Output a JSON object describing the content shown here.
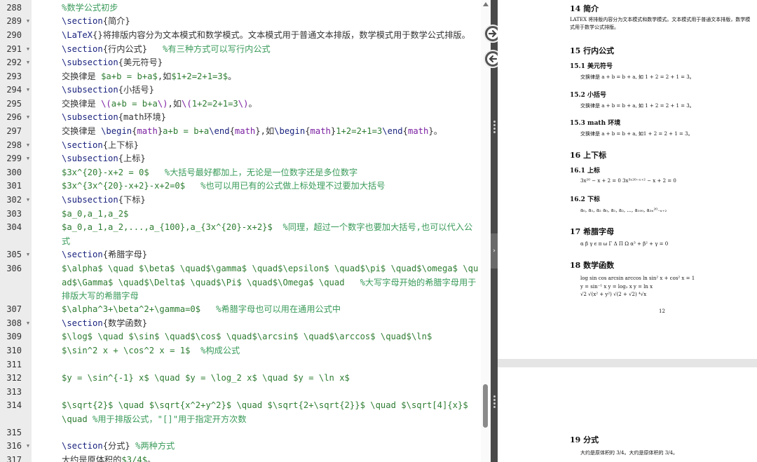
{
  "editor": {
    "lines": [
      {
        "num": "288",
        "fold": false,
        "segs": [
          [
            "t-comment",
            "%数学公式初步"
          ]
        ]
      },
      {
        "num": "289",
        "fold": true,
        "segs": [
          [
            "t-cmd",
            "\\section"
          ],
          [
            "t-brace",
            "{简介}"
          ]
        ]
      },
      {
        "num": "290",
        "fold": false,
        "segs": [
          [
            "t-cmd",
            "\\LaTeX"
          ],
          [
            "t-brace",
            "{}"
          ],
          [
            "t-text",
            "将排版内容分为文本模式和数学模式。文本模式用于普通文本排版，数学模式用于数学公式排版。"
          ]
        ]
      },
      {
        "num": "291",
        "fold": true,
        "segs": [
          [
            "t-cmd",
            "\\section"
          ],
          [
            "t-brace",
            "{行内公式}"
          ],
          [
            "t-comment",
            "   %有三种方式可以写行内公式"
          ]
        ]
      },
      {
        "num": "292",
        "fold": true,
        "segs": [
          [
            "t-cmd",
            "\\subsection"
          ],
          [
            "t-brace",
            "{美元符号}"
          ]
        ]
      },
      {
        "num": "293",
        "fold": false,
        "segs": [
          [
            "t-text",
            "交换律是 "
          ],
          [
            "t-math",
            "$a+b = b+a$"
          ],
          [
            "t-text",
            ",如"
          ],
          [
            "t-math",
            "$1+2=2+1=3$"
          ],
          [
            "t-text",
            "。"
          ]
        ]
      },
      {
        "num": "294",
        "fold": true,
        "segs": [
          [
            "t-cmd",
            "\\subsection"
          ],
          [
            "t-brace",
            "{小括号}"
          ]
        ]
      },
      {
        "num": "295",
        "fold": false,
        "segs": [
          [
            "t-text",
            "交换律是 "
          ],
          [
            "t-inner",
            "\\("
          ],
          [
            "t-math",
            "a+b = b+a"
          ],
          [
            "t-inner",
            "\\)"
          ],
          [
            "t-text",
            ",如"
          ],
          [
            "t-inner",
            "\\("
          ],
          [
            "t-math",
            "1+2=2+1=3"
          ],
          [
            "t-inner",
            "\\)"
          ],
          [
            "t-text",
            "。"
          ]
        ]
      },
      {
        "num": "296",
        "fold": true,
        "segs": [
          [
            "t-cmd",
            "\\subsection"
          ],
          [
            "t-brace",
            "{math环境}"
          ]
        ]
      },
      {
        "num": "297",
        "fold": false,
        "segs": [
          [
            "t-text",
            "交换律是 "
          ],
          [
            "t-cmd",
            "\\begin"
          ],
          [
            "t-brace",
            "{"
          ],
          [
            "t-inner",
            "math"
          ],
          [
            "t-brace",
            "}"
          ],
          [
            "t-math",
            "a+b = b+a"
          ],
          [
            "t-cmd",
            "\\end"
          ],
          [
            "t-brace",
            "{"
          ],
          [
            "t-inner",
            "math"
          ],
          [
            "t-brace",
            "}"
          ],
          [
            "t-text",
            ",如"
          ],
          [
            "t-cmd",
            "\\begin"
          ],
          [
            "t-brace",
            "{"
          ],
          [
            "t-inner",
            "math"
          ],
          [
            "t-brace",
            "}"
          ],
          [
            "t-math",
            "1+2=2+1=3"
          ],
          [
            "t-cmd",
            "\\end"
          ],
          [
            "t-brace",
            "{"
          ],
          [
            "t-inner",
            "math"
          ],
          [
            "t-brace",
            "}"
          ],
          [
            "t-text",
            "。"
          ]
        ]
      },
      {
        "num": "298",
        "fold": true,
        "segs": [
          [
            "t-cmd",
            "\\section"
          ],
          [
            "t-brace",
            "{上下标}"
          ]
        ]
      },
      {
        "num": "299",
        "fold": true,
        "segs": [
          [
            "t-cmd",
            "\\subsection"
          ],
          [
            "t-brace",
            "{上标}"
          ]
        ]
      },
      {
        "num": "300",
        "fold": false,
        "segs": [
          [
            "t-math",
            "$3x^{20}-x+2 = 0$"
          ],
          [
            "t-comment",
            "   %大括号最好都加上，无论是一位数字还是多位数字"
          ]
        ]
      },
      {
        "num": "301",
        "fold": false,
        "segs": [
          [
            "t-math",
            "$3x^{3x^{20}-x+2}-x+2=0$"
          ],
          [
            "t-comment",
            "   %也可以用已有的公式做上标处理不过要加大括号"
          ]
        ]
      },
      {
        "num": "302",
        "fold": true,
        "segs": [
          [
            "t-cmd",
            "\\subsection"
          ],
          [
            "t-brace",
            "{下标}"
          ]
        ]
      },
      {
        "num": "303",
        "fold": false,
        "segs": [
          [
            "t-math",
            "$a_0,a_1,a_2$"
          ]
        ]
      },
      {
        "num": "304",
        "fold": false,
        "segs": [
          [
            "t-math",
            "$a_0,a_1,a_2,...,a_{100},a_{3x^{20}-x+2}$"
          ],
          [
            "t-comment",
            "  %同理，超过一个数字也要加大括号,也可以代入公式"
          ]
        ]
      },
      {
        "num": "305",
        "fold": true,
        "segs": [
          [
            "t-cmd",
            "\\section"
          ],
          [
            "t-brace",
            "{希腊字母}"
          ]
        ]
      },
      {
        "num": "306",
        "fold": false,
        "segs": [
          [
            "t-math",
            "$\\alpha$ \\quad $\\beta$ \\quad$\\gamma$ \\quad$\\epsilon$ \\quad$\\pi$ \\quad$\\omega$ \\quad$\\Gamma$ \\quad$\\Delta$ \\quad$\\Pi$ \\quad$\\Omega$ \\quad"
          ],
          [
            "t-comment",
            "   %大写字母开始的希腊字母用于排版大写的希腊字母"
          ]
        ]
      },
      {
        "num": "307",
        "fold": false,
        "segs": [
          [
            "t-math",
            "$\\alpha^3+\\beta^2+\\gamma=0$"
          ],
          [
            "t-comment",
            "   %希腊字母也可以用在通用公式中"
          ]
        ]
      },
      {
        "num": "308",
        "fold": true,
        "segs": [
          [
            "t-cmd",
            "\\section"
          ],
          [
            "t-brace",
            "{数学函数}"
          ]
        ]
      },
      {
        "num": "309",
        "fold": false,
        "segs": [
          [
            "t-math",
            "$\\log$ \\quad $\\sin$ \\quad$\\cos$ \\quad$\\arcsin$ \\quad$\\arccos$ \\quad$\\ln$"
          ]
        ]
      },
      {
        "num": "310",
        "fold": false,
        "segs": [
          [
            "t-math",
            "$\\sin^2 x + \\cos^2 x = 1$"
          ],
          [
            "t-comment",
            "  %构成公式"
          ]
        ]
      },
      {
        "num": "311",
        "fold": false,
        "segs": []
      },
      {
        "num": "312",
        "fold": false,
        "segs": [
          [
            "t-math",
            "$y = \\sin^{-1} x$ \\quad $y = \\log_2 x$ \\quad $y = \\ln x$"
          ]
        ]
      },
      {
        "num": "313",
        "fold": false,
        "segs": []
      },
      {
        "num": "314",
        "fold": false,
        "segs": [
          [
            "t-math",
            "$\\sqrt{2}$ \\quad $\\sqrt{x^2+y^2}$ \\quad $\\sqrt{2+\\sqrt{2}}$ \\quad $\\sqrt[4]{x}$ \\quad "
          ],
          [
            "t-comment",
            "%用于排版公式，\"[]\"用于指定开方次数"
          ]
        ]
      },
      {
        "num": "315",
        "fold": false,
        "segs": []
      },
      {
        "num": "316",
        "fold": true,
        "segs": [
          [
            "t-cmd",
            "\\section"
          ],
          [
            "t-brace",
            "{分式}"
          ],
          [
            "t-comment",
            " %两种方式"
          ]
        ]
      },
      {
        "num": "317",
        "fold": false,
        "segs": [
          [
            "t-text",
            "大约是原体积的"
          ],
          [
            "t-math",
            "$3/4$"
          ],
          [
            "t-text",
            "。"
          ]
        ]
      }
    ]
  },
  "preview": {
    "page1": {
      "sec14": "14   简介",
      "sec14_body": "LATEX 将排版内容分为文本模式和数学模式。文本模式用于普通文本排版，数学模式用于数学公式排版。",
      "sec15": "15   行内公式",
      "sub151": "15.1   美元符号",
      "sub151_body": "交换律是 a + b = b + a, 如 1 + 2 = 2 + 1 = 3。",
      "sub152": "15.2   小括号",
      "sub152_body": "交换律是 a + b = b + a, 如 1 + 2 = 2 + 1 = 3。",
      "sub153": "15.3   math 环境",
      "sub153_body": "交换律是 a + b = b + a, 如1 + 2 = 2 + 1 = 3。",
      "sec16": "16   上下标",
      "sub161": "16.1   上标",
      "sub161_body": "3x²⁰ − x + 2 = 0  3x³ˣ²⁰⁻ˣ⁺² − x + 2 = 0",
      "sub162": "16.2   下标",
      "sub162_body": "a₀, a₁, a₂  a₀, a₁, a₂, ..., a₁₀₀, a₃ₓ²⁰₋ₓ₊₂",
      "sec17": "17   希腊字母",
      "sec17_body": "α    β    γ    ϵ    π    ω    Γ    Δ    Π    Ω    α³ + β² + γ = 0",
      "sec18": "18   数学函数",
      "sec18_line1": "log     sin     cos     arcsin     arccos     ln  sin² x + cos² x = 1",
      "sec18_line2": "y = sin⁻¹ x      y = log₂ x      y = ln x",
      "sec18_line3": "√2     √(x² + y²)     √(2 + √2)     ⁴√x",
      "page_number": "12"
    },
    "page2": {
      "sec19": "19   分式",
      "sec19_body": "大约是原体积的 3/4。大约是原体积的 3/4。"
    }
  }
}
